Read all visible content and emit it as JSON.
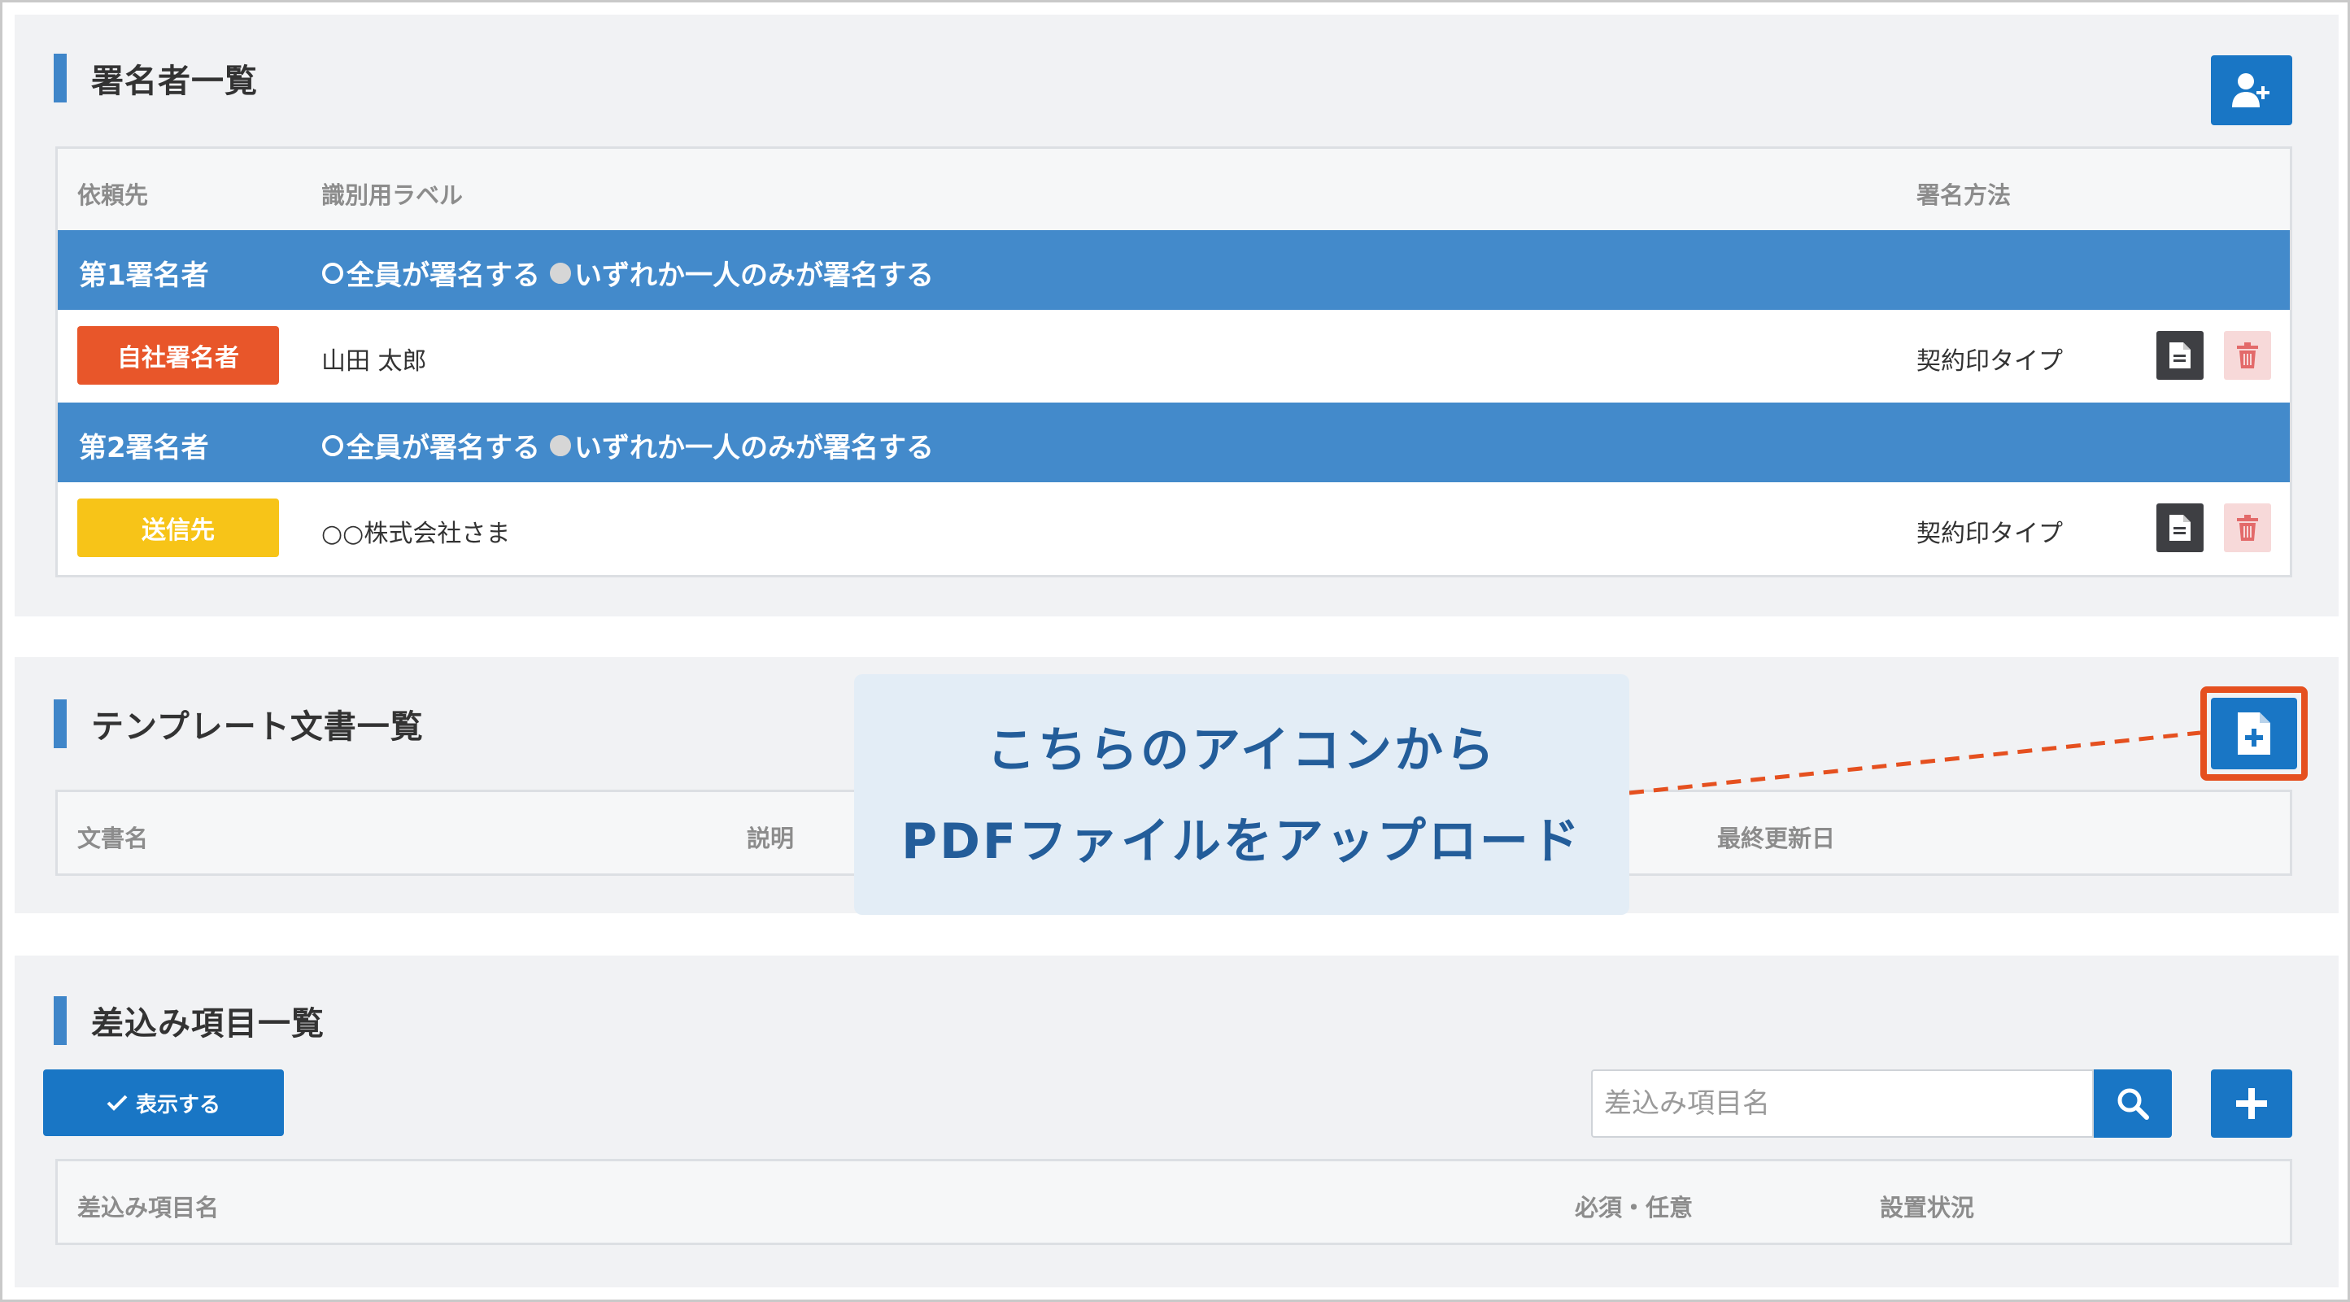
{
  "signers_section": {
    "title": "署名者一覧",
    "add_button_icon": "add-user-icon",
    "columns": {
      "requestee": "依頼先",
      "label": "識別用ラベル",
      "method": "署名方法"
    },
    "groups": [
      {
        "name": "第1署名者",
        "option_all": "全員が署名する",
        "option_any": "いずれか一人のみが署名する",
        "signer": {
          "badge": "自社署名者",
          "badge_color": "#e8562a",
          "name": "山田 太郎",
          "method": "契約印タイプ"
        }
      },
      {
        "name": "第2署名者",
        "option_all": "全員が署名する",
        "option_any": "いずれか一人のみが署名する",
        "signer": {
          "badge": "送信先",
          "badge_color": "#f7c418",
          "name": "○○株式会社さま",
          "method": "契約印タイプ"
        }
      }
    ]
  },
  "template_section": {
    "title": "テンプレート文書一覧",
    "upload_button_icon": "file-add-icon",
    "columns": {
      "doc_name": "文書名",
      "description": "説明",
      "updated": "最終更新日"
    }
  },
  "callout": {
    "line1": "こちらのアイコンから",
    "line2": "PDFファイルをアップロード"
  },
  "merge_section": {
    "title": "差込み項目一覧",
    "show_button": "表示する",
    "search_placeholder": "差込み項目名",
    "columns": {
      "field_name": "差込み項目名",
      "required": "必須・任意",
      "status": "設置状況"
    }
  },
  "colors": {
    "accent": "#1976c5",
    "group_header": "#438acb",
    "callout_text": "#235d9a",
    "highlight": "#e5501f"
  }
}
